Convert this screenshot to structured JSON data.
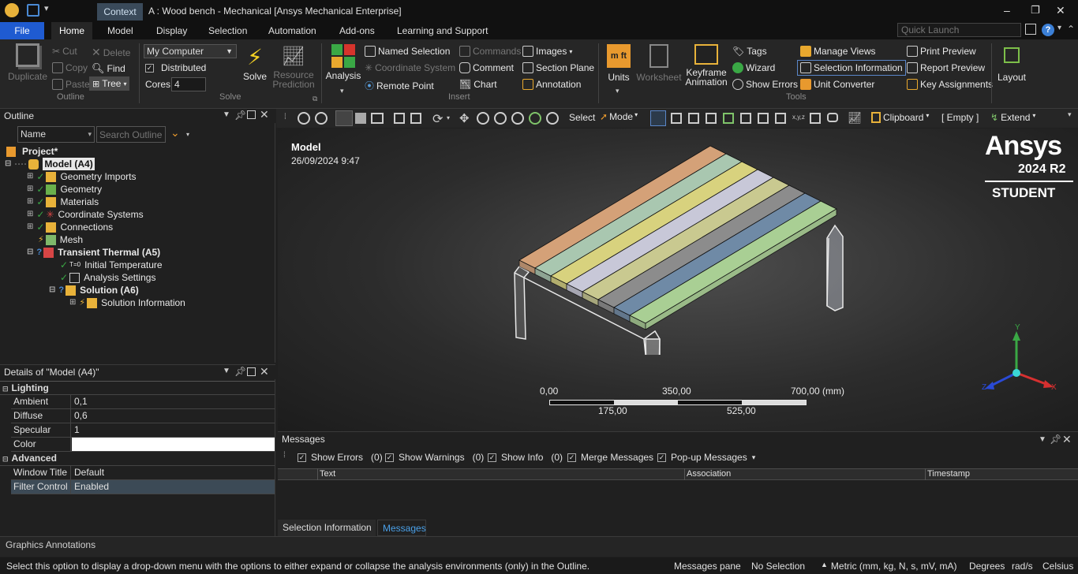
{
  "titlebar": {
    "context_tab": "Context",
    "title": "A : Wood bench - Mechanical [Ansys Mechanical Enterprise]",
    "minimize": "–",
    "restore": "❐",
    "close": "✕"
  },
  "menubar": {
    "file": "File",
    "tabs": [
      "Home",
      "Model",
      "Display",
      "Selection",
      "Automation",
      "Add-ons",
      "Learning and Support"
    ],
    "quick_launch_placeholder": "Quick Launch",
    "help": "?"
  },
  "ribbon": {
    "outline_group": {
      "duplicate": "Duplicate",
      "cut": "Cut",
      "copy": "Copy",
      "paste": "Paste",
      "delete": "Delete",
      "find": "Find",
      "tree": "Tree",
      "label": "Outline"
    },
    "solve_group": {
      "solver_target": "My Computer",
      "distributed": "Distributed",
      "cores_label": "Cores",
      "cores_value": "4",
      "solve": "Solve",
      "resource_prediction_1": "Resource",
      "resource_prediction_2": "Prediction",
      "label": "Solve"
    },
    "insert_group": {
      "analysis": "Analysis",
      "named_selection": "Named Selection",
      "coordinate_system": "Coordinate System",
      "remote_point": "Remote Point",
      "commands": "Commands",
      "comment": "Comment",
      "chart": "Chart",
      "images": "Images",
      "section_plane": "Section Plane",
      "annotation": "Annotation",
      "label": "Insert"
    },
    "tools_group": {
      "units": "Units",
      "worksheet": "Worksheet",
      "keyframe_1": "Keyframe",
      "keyframe_2": "Animation",
      "tags": "Tags",
      "wizard": "Wizard",
      "show_errors": "Show Errors",
      "manage_views": "Manage Views",
      "selection_information": "Selection Information",
      "unit_converter": "Unit Converter",
      "print_preview": "Print Preview",
      "report_preview": "Report Preview",
      "key_assignments": "Key Assignments",
      "label": "Tools"
    },
    "layout": "Layout"
  },
  "outline": {
    "title": "Outline",
    "name_filter": "Name",
    "search_placeholder": "Search Outline",
    "tree": [
      {
        "label": "Project*",
        "bold": true
      },
      {
        "label": "Model (A4)",
        "bold": true
      },
      {
        "label": "Geometry Imports"
      },
      {
        "label": "Geometry"
      },
      {
        "label": "Materials"
      },
      {
        "label": "Coordinate Systems"
      },
      {
        "label": "Connections"
      },
      {
        "label": "Mesh"
      },
      {
        "label": "Transient Thermal (A5)",
        "bold": true
      },
      {
        "label": "Initial Temperature"
      },
      {
        "label": "Analysis Settings"
      },
      {
        "label": "Solution (A6)",
        "bold": true
      },
      {
        "label": "Solution Information"
      }
    ]
  },
  "details": {
    "title": "Details of \"Model (A4)\"",
    "sections": [
      {
        "name": "Lighting"
      },
      {
        "name": "Advanced"
      }
    ],
    "rows": [
      {
        "key": "Ambient",
        "value": "0,1"
      },
      {
        "key": "Diffuse",
        "value": "0,6"
      },
      {
        "key": "Specular",
        "value": "1"
      },
      {
        "key": "Color",
        "value": ""
      },
      {
        "key": "Window Title",
        "value": "Default"
      },
      {
        "key": "Filter Control",
        "value": "Enabled"
      }
    ]
  },
  "graphics_toolbar": {
    "select": "Select",
    "mode": "Mode",
    "clipboard": "Clipboard",
    "empty": "[ Empty ]",
    "extend": "Extend"
  },
  "viewport": {
    "model_label": "Model",
    "timestamp": "26/09/2024 9:47",
    "brand": "Ansys",
    "version": "2024 R2",
    "edition": "STUDENT",
    "scale_top": [
      "0,00",
      "350,00",
      "700,00 (mm)"
    ],
    "scale_bottom": [
      "175,00",
      "525,00"
    ],
    "axis_y": "Y",
    "axis_x": "X",
    "axis_z": "Z",
    "plank_colors": [
      "#d4a178",
      "#a9c7b0",
      "#d8d27e",
      "#c8c8d8",
      "#c9c990",
      "#8c8c8c",
      "#6f8aa6",
      "#a9cf94"
    ]
  },
  "messages": {
    "title": "Messages",
    "filters": [
      {
        "label": "Show Errors",
        "count": "(0)"
      },
      {
        "label": "Show Warnings",
        "count": "(0)"
      },
      {
        "label": "Show Info",
        "count": "(0)"
      },
      {
        "label": "Merge Messages",
        "count": ""
      },
      {
        "label": "Pop-up Messages",
        "count": ""
      }
    ],
    "columns": [
      "Text",
      "Association",
      "Timestamp"
    ],
    "tabs": [
      "Selection Information",
      "Messages"
    ]
  },
  "graphics_annotations": "Graphics Annotations",
  "statusbar": {
    "hint": "Select this option to display a drop-down menu with the options to either expand or collapse the analysis environments (only) in the Outline.",
    "messages_pane": "Messages pane",
    "selection": "No Selection",
    "units": "Metric (mm, kg, N, s, mV, mA)",
    "angle": "Degrees",
    "ang_vel": "rad/s",
    "temp": "Celsius"
  }
}
